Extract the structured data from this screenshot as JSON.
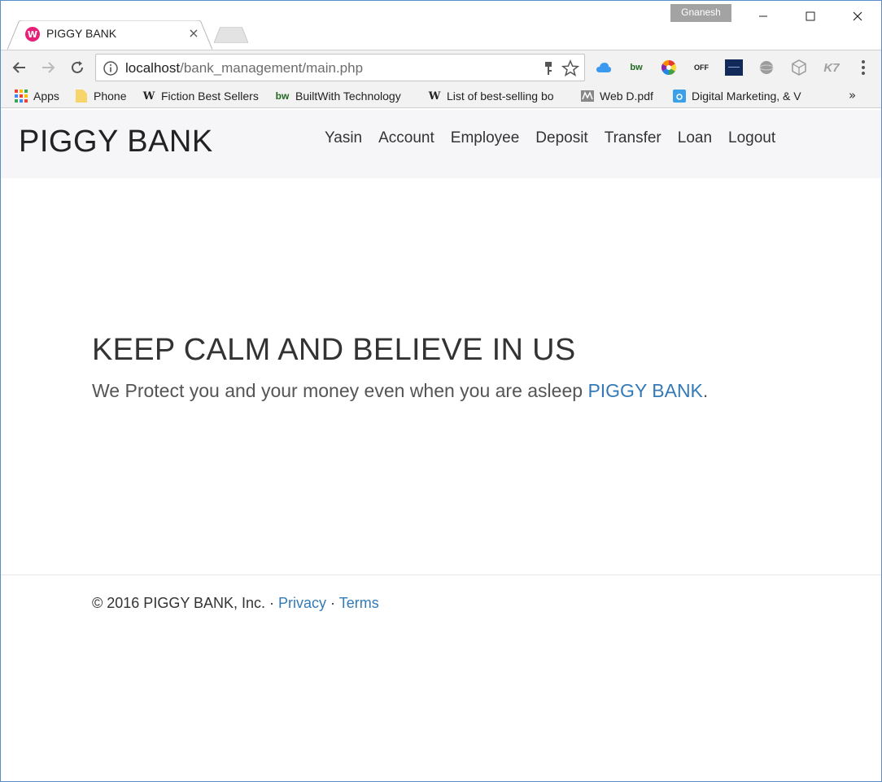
{
  "browser": {
    "tab_title": "PIGGY BANK",
    "profile_name": "Gnanesh",
    "url_host": "localhost",
    "url_path": "/bank_management/main.php",
    "favicon_letter": "W"
  },
  "bookmarks": [
    {
      "label": "Apps",
      "icon": "apps-grid-icon"
    },
    {
      "label": "Phone",
      "icon": "folder-icon"
    },
    {
      "label": "Fiction Best Sellers",
      "icon": "wikipedia-icon"
    },
    {
      "label": "BuiltWith Technology",
      "icon": "builtwith-icon"
    },
    {
      "label": "List of best-selling bo",
      "icon": "wikipedia-icon"
    },
    {
      "label": "Web D.pdf",
      "icon": "pdf-icon"
    },
    {
      "label": "Digital Marketing, & V",
      "icon": "bookmark-icon"
    }
  ],
  "extensions": [
    "cloud-icon",
    "bw-icon",
    "color-wheel-icon",
    "off-icon",
    "dark-extension-icon",
    "globe-icon",
    "cube-icon",
    "k7-icon"
  ],
  "extension_labels": {
    "bw": "bw",
    "off": "OFF",
    "k7": "K7"
  },
  "site": {
    "brand": "PIGGY BANK",
    "nav": [
      "Yasin",
      "Account",
      "Employee",
      "Deposit",
      "Transfer",
      "Loan",
      "Logout"
    ],
    "hero_title": "KEEP CALM AND BELIEVE IN US",
    "hero_sub_text": "We Protect you and your money even when you are asleep ",
    "hero_sub_link": "PIGGY BANK",
    "hero_sub_end": ".",
    "footer_text": "© 2016 PIGGY BANK, Inc. · ",
    "footer_privacy": "Privacy",
    "footer_sep": " · ",
    "footer_terms": "Terms"
  },
  "colors": {
    "link": "#337ab7",
    "navbar_bg": "#f6f6f8",
    "favicon": "#e91e78"
  }
}
